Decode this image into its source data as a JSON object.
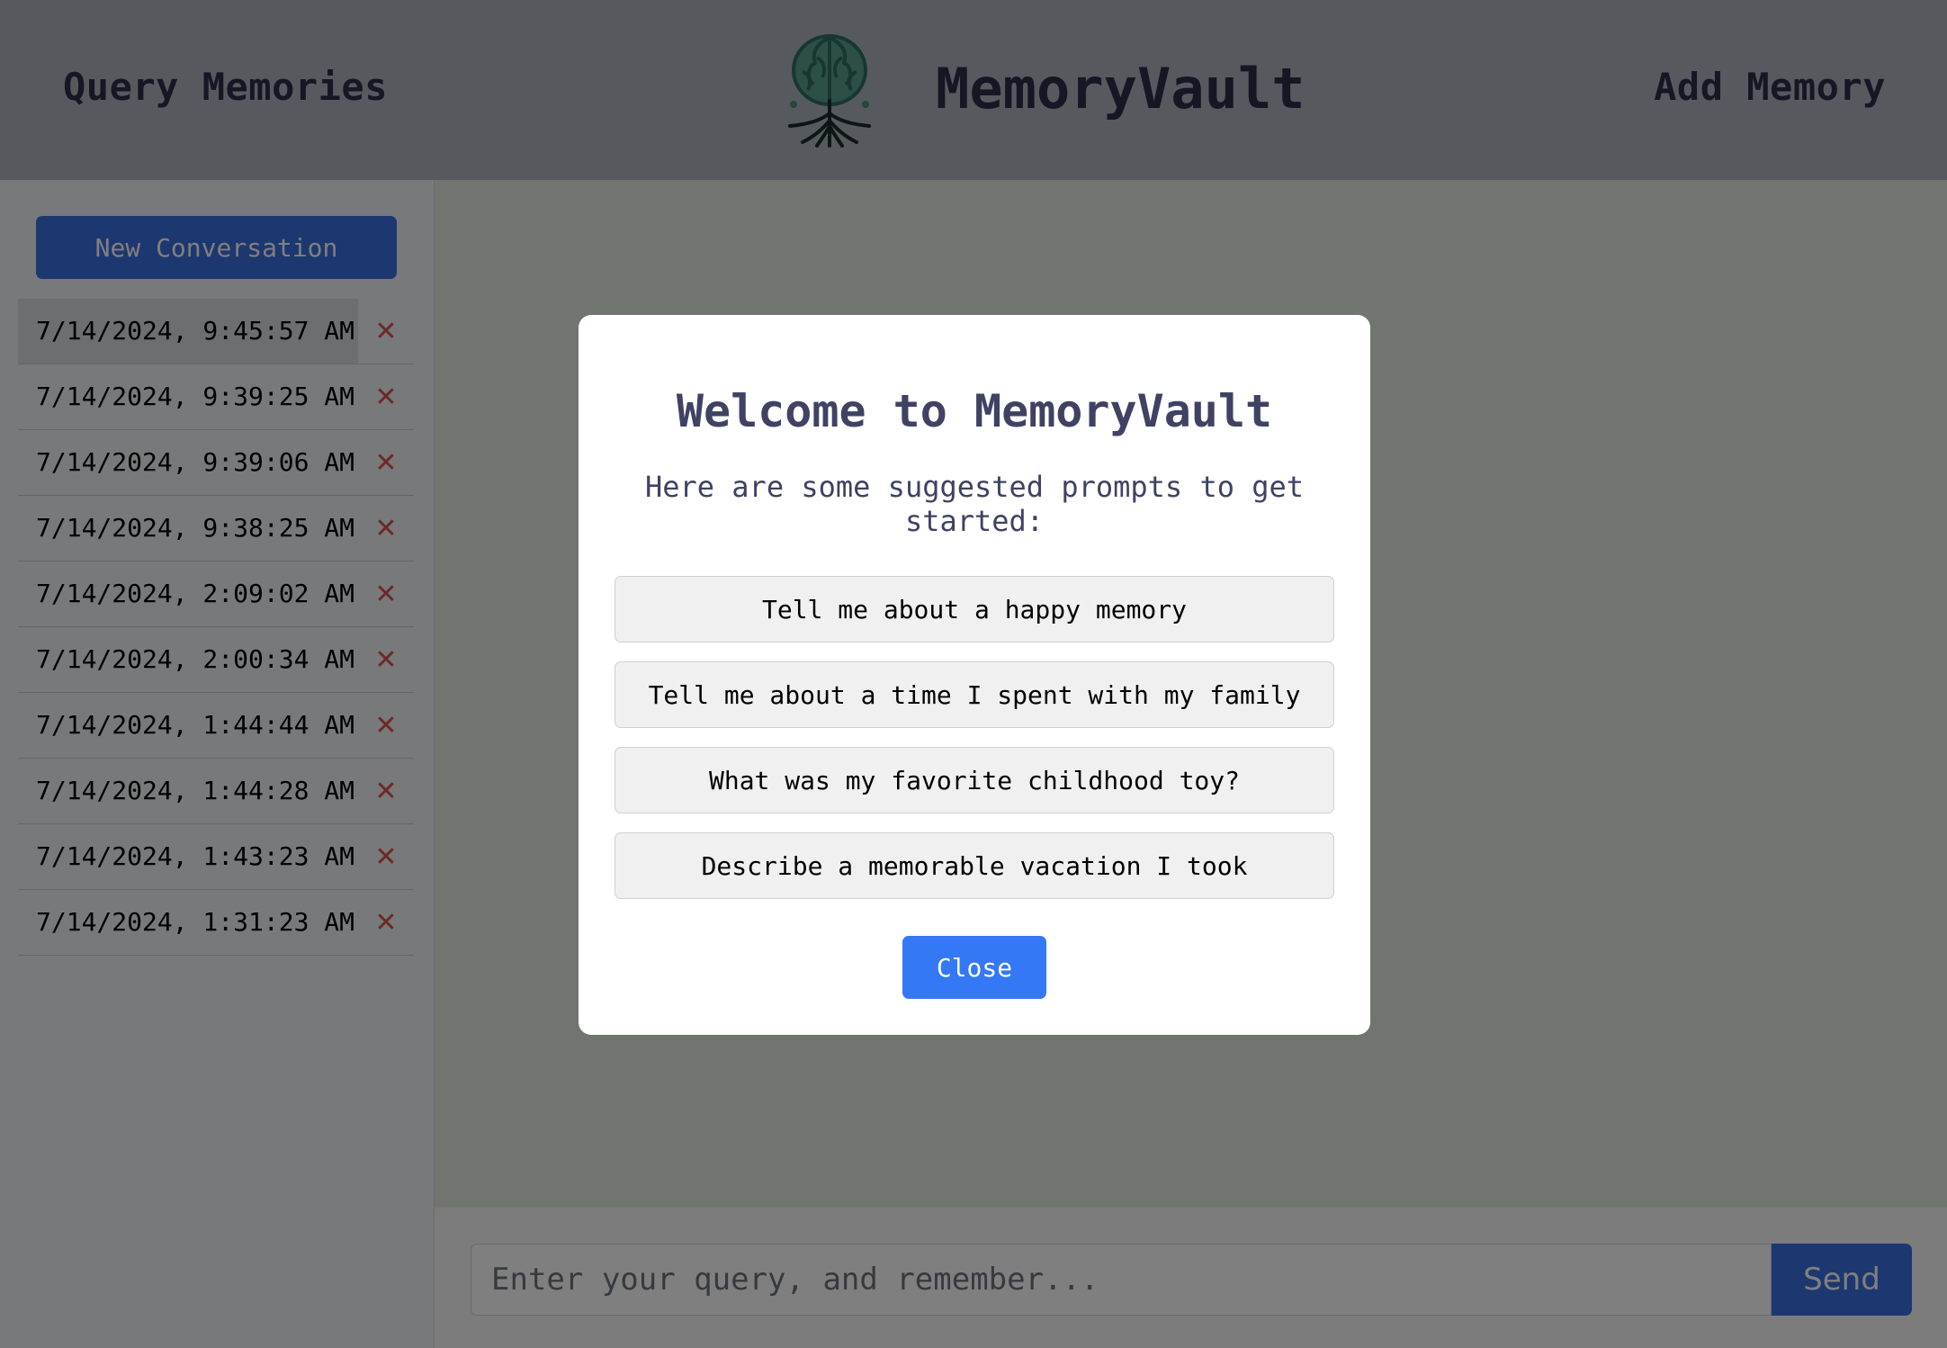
{
  "header": {
    "query_link": "Query Memories",
    "brand_name": "MemoryVault",
    "add_link": "Add Memory",
    "logo_icon": "tree-brain-logo"
  },
  "sidebar": {
    "new_conversation_label": "New Conversation",
    "delete_glyph": "✕",
    "conversations": [
      {
        "label": "7/14/2024, 9:45:57 AM"
      },
      {
        "label": "7/14/2024, 9:39:25 AM"
      },
      {
        "label": "7/14/2024, 9:39:06 AM"
      },
      {
        "label": "7/14/2024, 9:38:25 AM"
      },
      {
        "label": "7/14/2024, 2:09:02 AM"
      },
      {
        "label": "7/14/2024, 2:00:34 AM"
      },
      {
        "label": "7/14/2024, 1:44:44 AM"
      },
      {
        "label": "7/14/2024, 1:44:28 AM"
      },
      {
        "label": "7/14/2024, 1:43:23 AM"
      },
      {
        "label": "7/14/2024, 1:31:23 AM"
      }
    ]
  },
  "chat": {
    "input_placeholder": "Enter your query, and remember...",
    "send_label": "Send"
  },
  "modal": {
    "title": "Welcome to MemoryVault",
    "subtitle": "Here are some suggested prompts to get started:",
    "prompts": [
      "Tell me about a happy memory",
      "Tell me about a time I spent with my family",
      "What was my favorite childhood toy?",
      "Describe a memorable vacation I took"
    ],
    "close_label": "Close"
  },
  "colors": {
    "header_bg": "#adb5bd",
    "primary_blue": "#3b6fe0",
    "close_blue": "#3478f6",
    "delete_red": "#d9534f",
    "title_text": "#3f4263"
  }
}
